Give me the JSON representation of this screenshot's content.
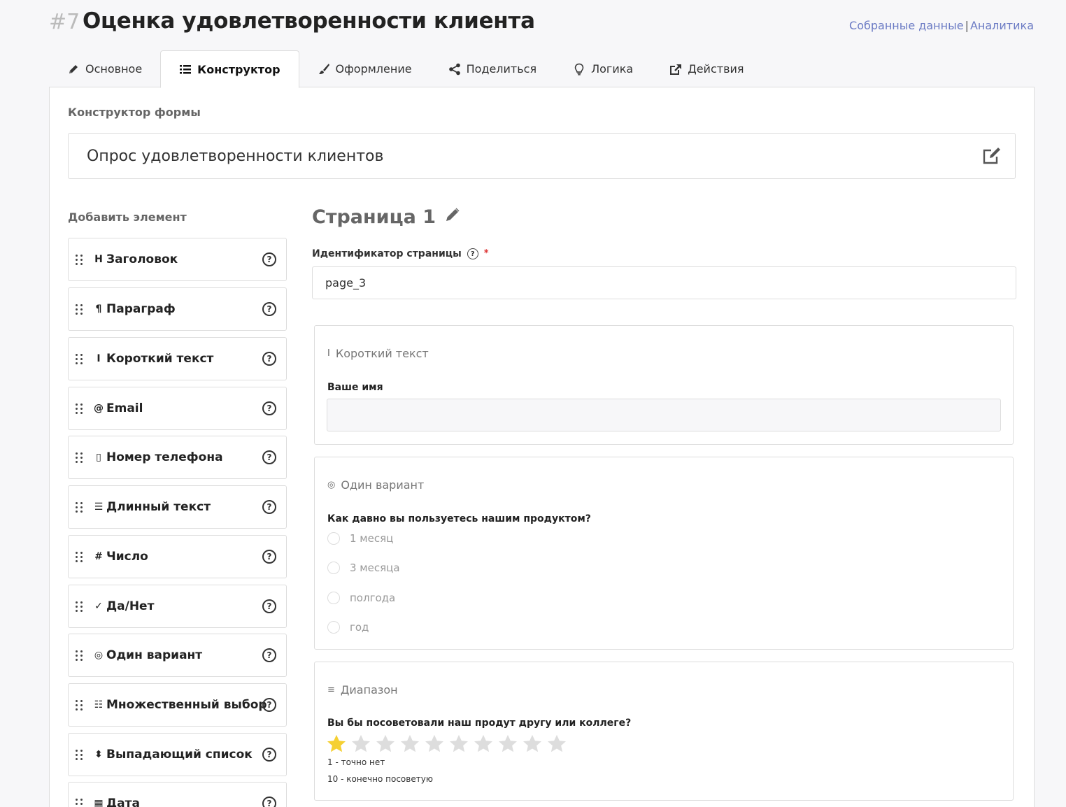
{
  "header": {
    "number": "#7",
    "title": "Оценка удовлетворенности клиента",
    "link_collected": "Собранные данные",
    "separator": "|",
    "link_analytics": "Аналитика"
  },
  "tabs": [
    {
      "label": "Основное",
      "icon": "pencil-icon"
    },
    {
      "label": "Конструктор",
      "icon": "list-icon",
      "active": true
    },
    {
      "label": "Оформление",
      "icon": "brush-icon"
    },
    {
      "label": "Поделиться",
      "icon": "share-icon"
    },
    {
      "label": "Логика",
      "icon": "lightbulb-icon"
    },
    {
      "label": "Действия",
      "icon": "external-link-icon"
    }
  ],
  "builder": {
    "section_label": "Конструктор формы",
    "form_title": "Опрос удовлетворенности клиентов"
  },
  "add_element": {
    "label": "Добавить элемент",
    "items": [
      {
        "icon": "H",
        "label": "Заголовок"
      },
      {
        "icon": "¶",
        "label": "Параграф"
      },
      {
        "icon": "I",
        "label": "Короткий текст"
      },
      {
        "icon": "@",
        "label": "Email"
      },
      {
        "icon": "▯",
        "label": "Номер телефона"
      },
      {
        "icon": "☰",
        "label": "Длинный текст"
      },
      {
        "icon": "#",
        "label": "Число"
      },
      {
        "icon": "✓",
        "label": "Да/Нет"
      },
      {
        "icon": "◎",
        "label": "Один вариант"
      },
      {
        "icon": "☷",
        "label": "Множественный выбор"
      },
      {
        "icon": "⬍",
        "label": "Выпадающий список"
      },
      {
        "icon": "▦",
        "label": "Дата"
      }
    ],
    "help": "?"
  },
  "page": {
    "title": "Страница 1",
    "id_label": "Идентификатор страницы",
    "id_required": "*",
    "id_value": "page_3"
  },
  "cards": {
    "short_text": {
      "type_icon": "I",
      "type_label": "Короткий текст",
      "question": "Ваше имя"
    },
    "single_choice": {
      "type_icon": "◎",
      "type_label": "Один вариант",
      "question": "Как давно вы пользуетесь нашим продуктом?",
      "options": [
        "1 месяц",
        "3 месяца",
        "полгода",
        "год"
      ]
    },
    "range": {
      "type_icon": "≡",
      "type_label": "Диапазон",
      "question": "Вы бы посоветовали наш продут другу или коллеге?",
      "stars_total": 10,
      "stars_filled": 1,
      "star_color": "#f5d033",
      "star_empty_color": "#dddddd",
      "min_note": "1 - точно нет",
      "max_note": "10 - конечно посоветую"
    }
  }
}
